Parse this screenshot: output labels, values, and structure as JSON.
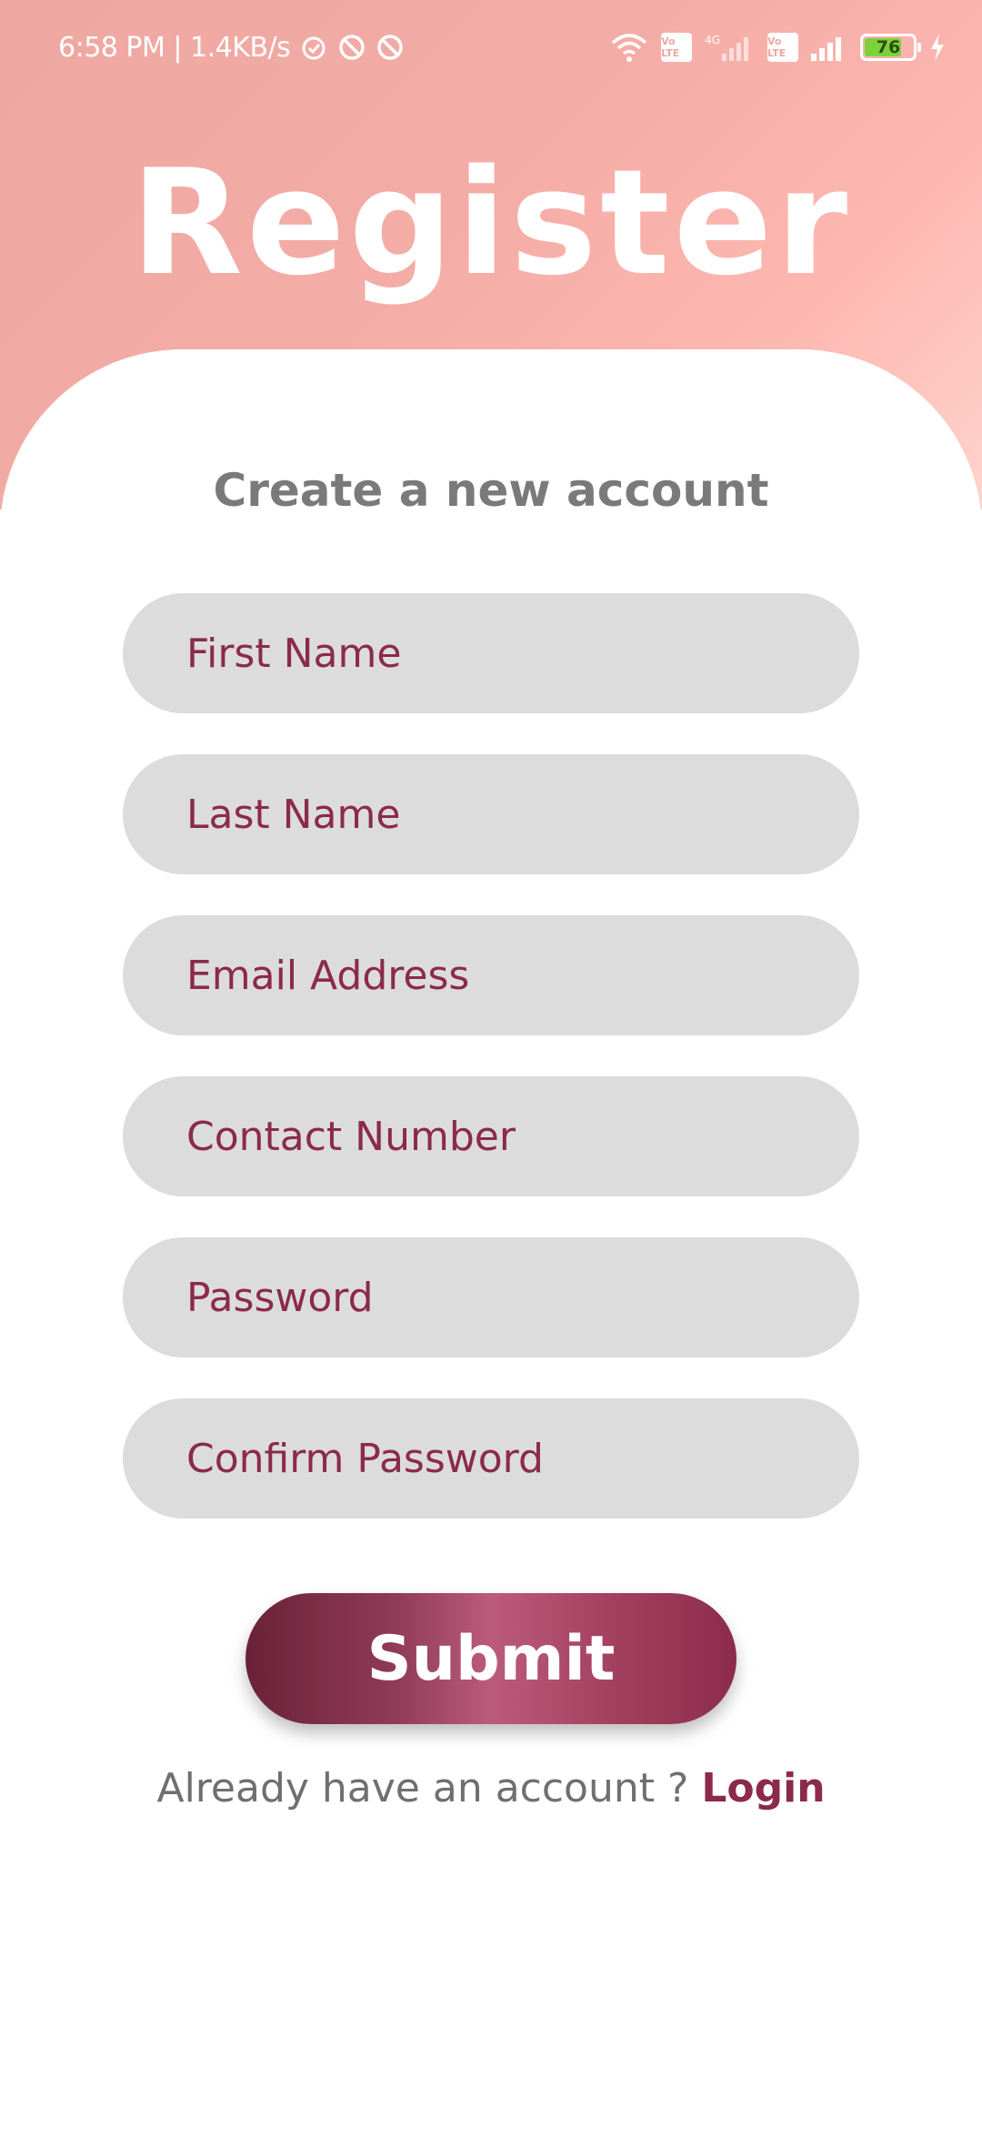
{
  "status_bar": {
    "time_speed": "6:58 PM | 1.4KB/s",
    "network_4g": "4G",
    "volte_label": "Vo LTE",
    "battery_level": "76",
    "icons": [
      "alarm-icon",
      "blocked-icon",
      "blocked-icon",
      "wifi-icon",
      "volte-icon",
      "signal-icon",
      "volte-icon",
      "signal-icon",
      "battery-icon",
      "charging-icon"
    ]
  },
  "header": {
    "title": "Register"
  },
  "form": {
    "subtitle": "Create a new account",
    "fields": [
      {
        "placeholder": "First Name",
        "value": ""
      },
      {
        "placeholder": "Last Name",
        "value": ""
      },
      {
        "placeholder": "Email Address",
        "value": ""
      },
      {
        "placeholder": "Contact Number",
        "value": ""
      },
      {
        "placeholder": "Password",
        "value": ""
      },
      {
        "placeholder": "Confirm Password",
        "value": ""
      }
    ],
    "submit_label": "Submit"
  },
  "footer": {
    "prompt": "Already have an account ?",
    "login_label": "Login"
  },
  "colors": {
    "header_gradient_start": "#eda8a1",
    "header_gradient_end": "#ffd3cb",
    "field_background": "#dcdcdc",
    "accent": "#8b2a4a",
    "subtitle_text": "#7a7a7a"
  }
}
